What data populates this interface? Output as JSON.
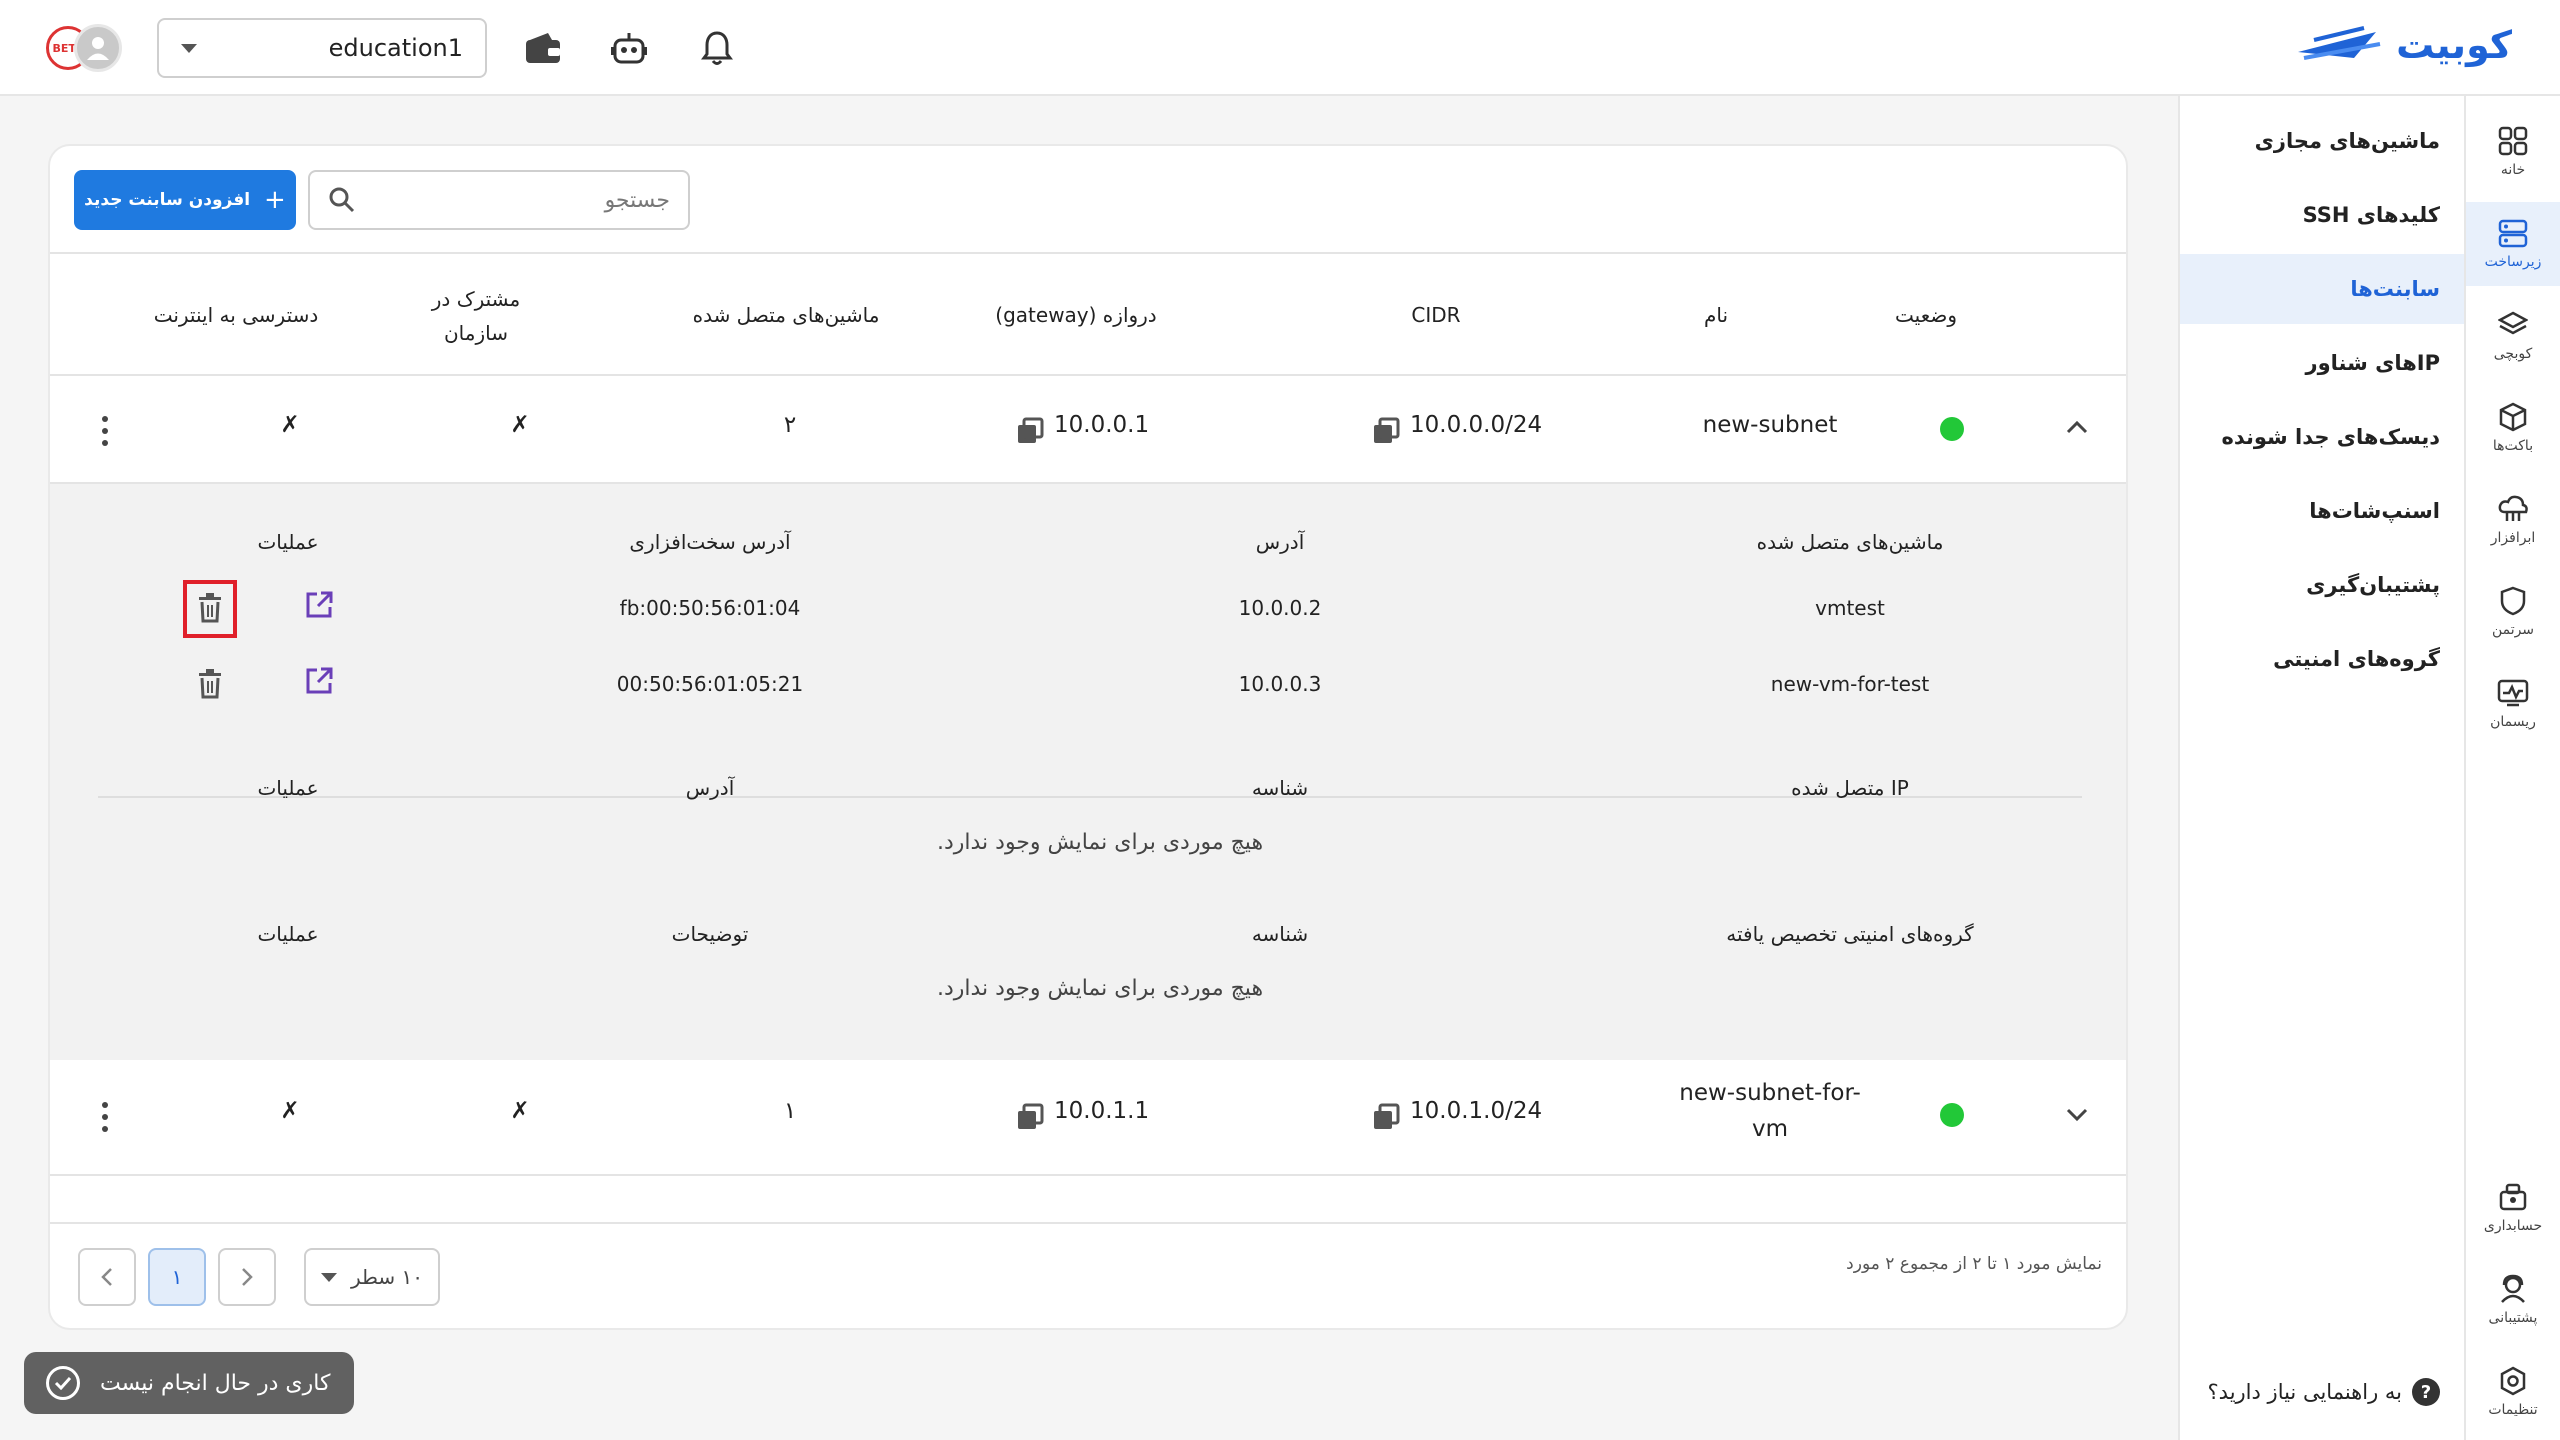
{
  "header": {
    "logo_text": "کوبیت",
    "project_selector": {
      "value": "education1"
    },
    "icons": [
      "wallet-icon",
      "robot-icon",
      "bell-icon"
    ],
    "avatar_badge": "BETA"
  },
  "rail": {
    "items": [
      {
        "label": "خانه",
        "icon": "grid-icon"
      },
      {
        "label": "زیرساخت",
        "icon": "server-icon",
        "active": true
      },
      {
        "label": "کوبچی",
        "icon": "layers-icon"
      },
      {
        "label": "باکت‌ها",
        "icon": "cube-icon"
      },
      {
        "label": "ابرافزار",
        "icon": "cloud-app-icon"
      },
      {
        "label": "سرتمن",
        "icon": "shield-icon"
      },
      {
        "label": "ریسمان",
        "icon": "monitor-icon"
      },
      {
        "label": "حسابداری",
        "icon": "accounting-icon"
      },
      {
        "label": "پشتیبانی",
        "icon": "support-icon"
      },
      {
        "label": "تنظیمات",
        "icon": "settings-icon"
      }
    ]
  },
  "sidemenu": {
    "items": [
      {
        "label": "ماشین‌های مجازی"
      },
      {
        "label": "کلیدهای SSH"
      },
      {
        "label": "سابنت‌ها",
        "active": true
      },
      {
        "label": "IPهای شناور"
      },
      {
        "label": "دیسک‌های جدا شونده"
      },
      {
        "label": "اسنپ‌شات‌ها"
      },
      {
        "label": "پشتیبان‌گیری"
      },
      {
        "label": "گروه‌های امنیتی"
      }
    ],
    "help": "به راهنمایی نیاز دارید؟"
  },
  "toolbar": {
    "add_button": "افزودن سابنت جدید",
    "search_placeholder": "جستجو"
  },
  "table": {
    "headers": {
      "status": "وضعیت",
      "name": "نام",
      "cidr": "CIDR",
      "gateway": "دروازه (gateway)",
      "machines": "ماشین‌های متصل شده",
      "shared_line1": "مشترک در",
      "shared_line2": "سازمان",
      "internet": "دسترسی به اینترنت"
    },
    "rows": [
      {
        "name": "new-subnet",
        "cidr": "10.0.0.0/24",
        "gateway": "10.0.0.1",
        "machines": "۲",
        "shared": "✗",
        "internet": "✗",
        "status_color": "#22c838"
      },
      {
        "name_line1": "new-subnet-for-",
        "name_line2": "vm",
        "cidr": "10.0.1.0/24",
        "gateway": "10.0.1.1",
        "machines": "۱",
        "shared": "✗",
        "internet": "✗",
        "status_color": "#22c838"
      }
    ]
  },
  "details": {
    "machines": {
      "headers": {
        "name": "ماشین‌های متصل شده",
        "address": "آدرس",
        "mac": "آدرس سخت‌افزاری",
        "ops": "عملیات"
      },
      "rows": [
        {
          "name": "vmtest",
          "address": "10.0.0.2",
          "mac": "fb:00:50:56:01:04"
        },
        {
          "name": "new-vm-for-test",
          "address": "10.0.0.3",
          "mac": "00:50:56:01:05:21"
        }
      ]
    },
    "ips": {
      "headers": {
        "ip": "IP متصل شده",
        "id": "شناسه",
        "address": "آدرس",
        "ops": "عملیات"
      },
      "empty": "هیچ موردی برای نمایش وجود ندارد."
    },
    "security_groups": {
      "headers": {
        "name": "گروه‌های امنیتی تخصیص یافته",
        "id": "شناسه",
        "desc": "توضیحات",
        "ops": "عملیات"
      },
      "empty": "هیچ موردی برای نمایش وجود ندارد."
    }
  },
  "pagination": {
    "info": "نمایش مورد ۱ تا ۲ از مجموع ۲ مورد",
    "rows_per_page": "۱۰ سطر",
    "current_page": "۱"
  },
  "toast": {
    "text": "کاری در حال انجام نیست"
  },
  "colors": {
    "accent": "#1f7ae0",
    "status_ok": "#22c838",
    "highlight": "#e0202a"
  }
}
